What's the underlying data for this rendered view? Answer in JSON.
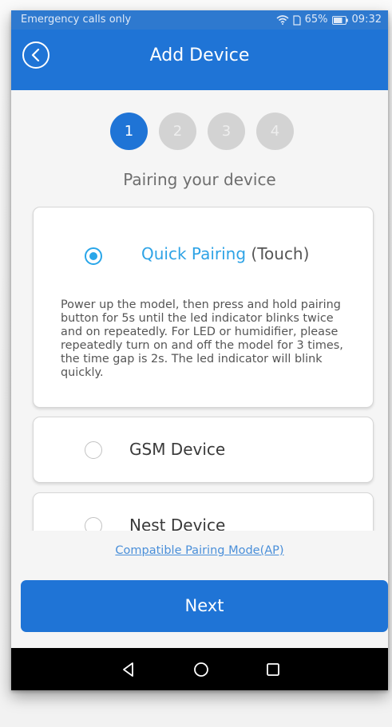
{
  "status_bar": {
    "carrier_text": "Emergency calls only",
    "battery_percent": "65%",
    "time": "09:32"
  },
  "header": {
    "title": "Add Device",
    "back_icon": "chevron-left-circle-icon"
  },
  "steps": [
    {
      "label": "1",
      "active": true
    },
    {
      "label": "2",
      "active": false
    },
    {
      "label": "3",
      "active": false
    },
    {
      "label": "4",
      "active": false
    }
  ],
  "pairing_title": "Pairing your device",
  "options": [
    {
      "label": "Quick Pairing",
      "suffix": "(Touch)",
      "selected": true,
      "description": "Power up the model, then press and hold pairing button for 5s until the led indicator blinks twice and on repeatedly. For LED or humidifier, please repeatedly turn on and off the model for 3 times, the time gap is 2s. The led indicator will blink quickly."
    },
    {
      "label": "GSM Device",
      "selected": false
    },
    {
      "label": "Nest Device",
      "selected": false
    }
  ],
  "compat_link": "Compatible Pairing Mode(AP)",
  "next_button": "Next",
  "nav": {
    "back_icon": "triangle-back-icon",
    "home_icon": "circle-home-icon",
    "recents_icon": "square-recents-icon"
  },
  "colors": {
    "primary": "#1f74d6",
    "accent": "#29a6e9",
    "inactive_step": "#d3d3d3"
  }
}
